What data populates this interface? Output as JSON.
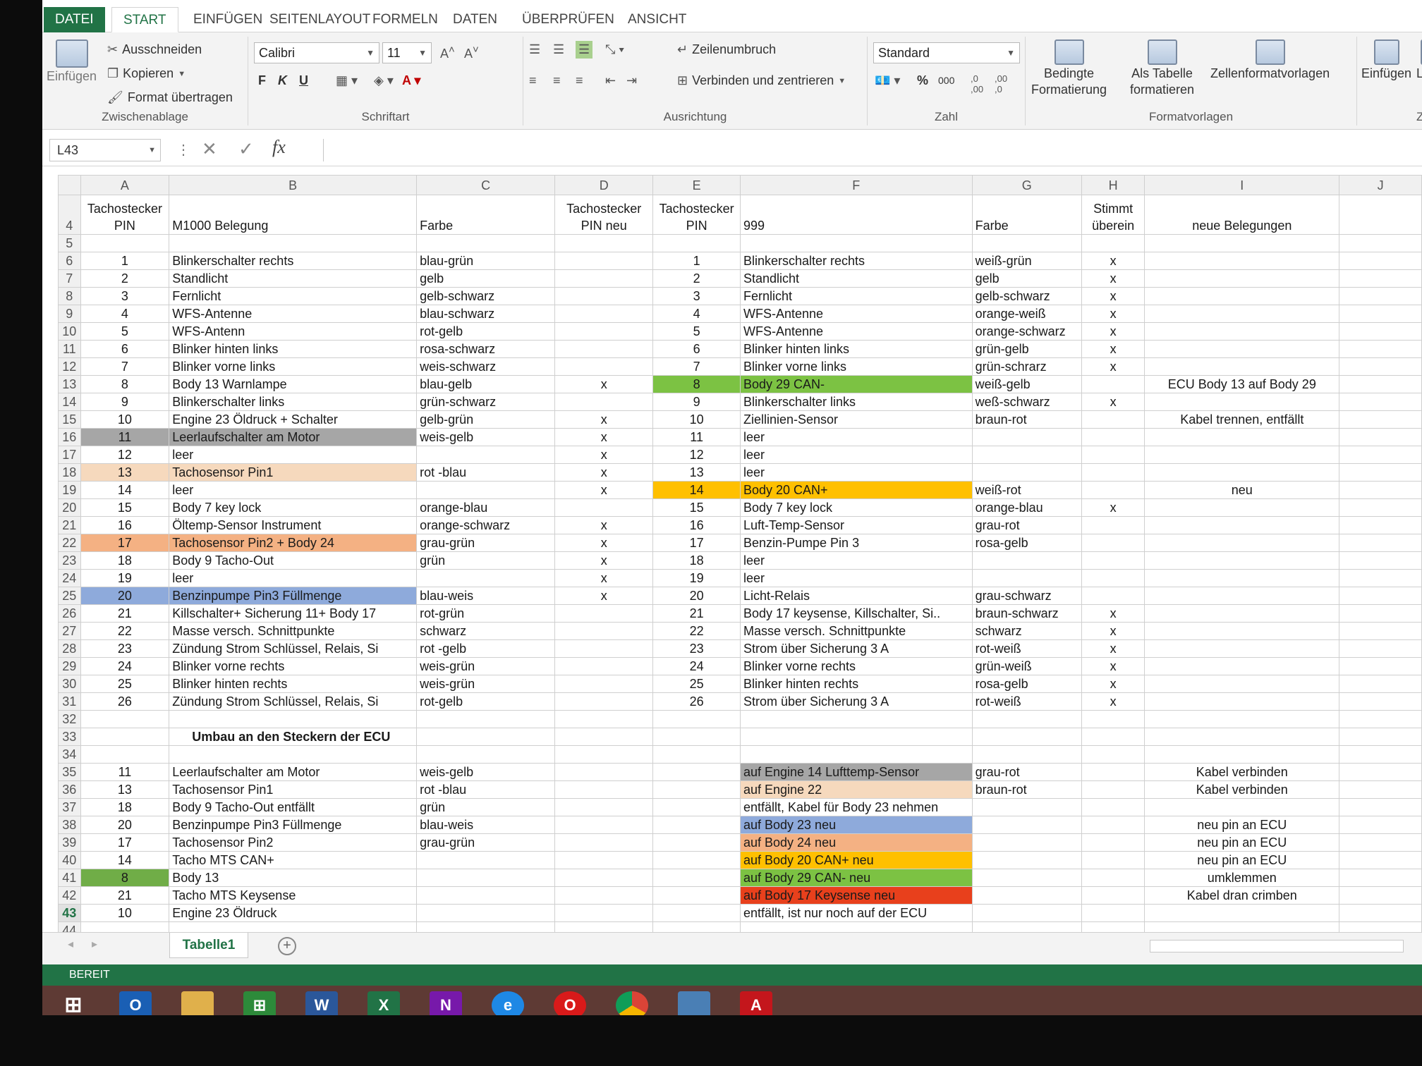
{
  "ribbon_tabs": [
    "DATEI",
    "START",
    "EINFÜGEN",
    "SEITENLAYOUT",
    "FORMELN",
    "DATEN",
    "ÜBERPRÜFEN",
    "ANSICHT"
  ],
  "clipboard": {
    "paste": "Einfügen",
    "cut": "Ausschneiden",
    "copy": "Kopieren",
    "format_painter": "Format übertragen",
    "label": "Zwischenablage"
  },
  "font": {
    "name": "Calibri",
    "size": "11",
    "bold": "F",
    "italic": "K",
    "underline": "U",
    "label": "Schriftart"
  },
  "alignment": {
    "wrap": "Zeilenumbruch",
    "merge": "Verbinden und zentrieren",
    "label": "Ausrichtung"
  },
  "number": {
    "format": "Standard",
    "percent": "%",
    "thousands": "000",
    "label": "Zahl"
  },
  "styles": {
    "conditional_1": "Bedingte",
    "conditional_2": "Formatierung",
    "as_table_1": "Als Tabelle",
    "as_table_2": "formatieren",
    "cell_styles": "Zellenformatvorlagen",
    "label": "Formatvorlagen"
  },
  "cells": {
    "insert": "Einfügen",
    "delete": "Lösch",
    "label": "Zellen"
  },
  "formula_bar": {
    "name_box": "L43",
    "fx": "fx"
  },
  "columns": [
    "A",
    "B",
    "C",
    "D",
    "E",
    "F",
    "G",
    "H",
    "I",
    "J"
  ],
  "header_row": {
    "a1": "Tachostecker",
    "a2": "PIN",
    "b": "M1000 Belegung",
    "c": "Farbe",
    "d1": "Tachostecker",
    "d2": "PIN neu",
    "e1": "Tachostecker",
    "e2": "PIN",
    "f": "999",
    "g": "Farbe",
    "h1": "Stimmt",
    "h2": "überein",
    "i": "neue Belegungen"
  },
  "rows": [
    {
      "n": "6",
      "a": "1",
      "b": "Blinkerschalter rechts",
      "c": "blau-grün",
      "d": "",
      "e": "1",
      "f": "Blinkerschalter rechts",
      "g": "weiß-grün",
      "h": "x",
      "i": ""
    },
    {
      "n": "7",
      "a": "2",
      "b": "Standlicht",
      "c": "gelb",
      "d": "",
      "e": "2",
      "f": "Standlicht",
      "g": "gelb",
      "h": "x",
      "i": ""
    },
    {
      "n": "8",
      "a": "3",
      "b": "Fernlicht",
      "c": "gelb-schwarz",
      "d": "",
      "e": "3",
      "f": "Fernlicht",
      "g": "gelb-schwarz",
      "h": "x",
      "i": ""
    },
    {
      "n": "9",
      "a": "4",
      "b": "WFS-Antenne",
      "c": "blau-schwarz",
      "d": "",
      "e": "4",
      "f": "WFS-Antenne",
      "g": "orange-weiß",
      "h": "x",
      "i": ""
    },
    {
      "n": "10",
      "a": "5",
      "b": "WFS-Antenn",
      "c": "rot-gelb",
      "d": "",
      "e": "5",
      "f": "WFS-Antenne",
      "g": "orange-schwarz",
      "h": "x",
      "i": ""
    },
    {
      "n": "11",
      "a": "6",
      "b": "Blinker hinten links",
      "c": "rosa-schwarz",
      "d": "",
      "e": "6",
      "f": "Blinker hinten links",
      "g": "grün-gelb",
      "h": "x",
      "i": ""
    },
    {
      "n": "12",
      "a": "7",
      "b": "Blinker vorne links",
      "c": "weis-schwarz",
      "d": "",
      "e": "7",
      "f": "Blinker vorne links",
      "g": "grün-schrarz",
      "h": "x",
      "i": ""
    },
    {
      "n": "13",
      "a": "8",
      "b": "Body 13 Warnlampe",
      "c": "blau-gelb",
      "d": "x",
      "e": "8",
      "f": "Body 29 CAN-",
      "g": "weiß-gelb",
      "h": "",
      "i": "ECU Body 13 auf Body 29",
      "fill_e": "#7cc243",
      "fill_f": "#7cc243"
    },
    {
      "n": "14",
      "a": "9",
      "b": "Blinkerschalter links",
      "c": "grün-schwarz",
      "d": "",
      "e": "9",
      "f": "Blinkerschalter links",
      "g": "weß-schwarz",
      "h": "x",
      "i": ""
    },
    {
      "n": "15",
      "a": "10",
      "b": "Engine 23 Öldruck + Schalter",
      "c": "gelb-grün",
      "d": "x",
      "e": "10",
      "f": "Ziellinien-Sensor",
      "g": "braun-rot",
      "h": "",
      "i": "Kabel trennen, entfällt"
    },
    {
      "n": "16",
      "a": "11",
      "b": "Leerlaufschalter am Motor",
      "c": "weis-gelb",
      "d": "x",
      "e": "11",
      "f": "leer",
      "g": "",
      "h": "",
      "i": "",
      "fill_a": "#a6a6a6",
      "fill_b": "#a6a6a6"
    },
    {
      "n": "17",
      "a": "12",
      "b": "leer",
      "c": "",
      "d": "x",
      "e": "12",
      "f": "leer",
      "g": "",
      "h": "",
      "i": ""
    },
    {
      "n": "18",
      "a": "13",
      "b": "Tachosensor Pin1",
      "c": "rot -blau",
      "d": "x",
      "e": "13",
      "f": "leer",
      "g": "",
      "h": "",
      "i": "",
      "fill_a": "#f6d9bd",
      "fill_b": "#f6d9bd"
    },
    {
      "n": "19",
      "a": "14",
      "b": "leer",
      "c": "",
      "d": "x",
      "e": "14",
      "f": "Body 20 CAN+",
      "g": "weiß-rot",
      "h": "",
      "i": "neu",
      "fill_e": "#ffc000",
      "fill_f": "#ffc000"
    },
    {
      "n": "20",
      "a": "15",
      "b": "Body 7 key lock",
      "c": "orange-blau",
      "d": "",
      "e": "15",
      "f": "Body 7 key lock",
      "g": "orange-blau",
      "h": "x",
      "i": ""
    },
    {
      "n": "21",
      "a": "16",
      "b": "Öltemp-Sensor Instrument",
      "c": "orange-schwarz",
      "d": "x",
      "e": "16",
      "f": "Luft-Temp-Sensor",
      "g": "grau-rot",
      "h": "",
      "i": ""
    },
    {
      "n": "22",
      "a": "17",
      "b": "Tachosensor Pin2 + Body 24",
      "c": "grau-grün",
      "d": "x",
      "e": "17",
      "f": "Benzin-Pumpe Pin 3",
      "g": "rosa-gelb",
      "h": "",
      "i": "",
      "fill_a": "#f4b183",
      "fill_b": "#f4b183"
    },
    {
      "n": "23",
      "a": "18",
      "b": "Body 9 Tacho-Out",
      "c": "grün",
      "d": "x",
      "e": "18",
      "f": "leer",
      "g": "",
      "h": "",
      "i": ""
    },
    {
      "n": "24",
      "a": "19",
      "b": "leer",
      "c": "",
      "d": "x",
      "e": "19",
      "f": "leer",
      "g": "",
      "h": "",
      "i": ""
    },
    {
      "n": "25",
      "a": "20",
      "b": "Benzinpumpe Pin3 Füllmenge",
      "c": "blau-weis",
      "d": "x",
      "e": "20",
      "f": "Licht-Relais",
      "g": "grau-schwarz",
      "h": "",
      "i": "",
      "fill_a": "#8eaadb",
      "fill_b": "#8eaadb"
    },
    {
      "n": "26",
      "a": "21",
      "b": "Killschalter+ Sicherung 11+ Body 17",
      "c": "rot-grün",
      "d": "",
      "e": "21",
      "f": "Body 17 keysense, Killschalter, Si..",
      "g": "braun-schwarz",
      "h": "x",
      "i": ""
    },
    {
      "n": "27",
      "a": "22",
      "b": "Masse versch. Schnittpunkte",
      "c": "schwarz",
      "d": "",
      "e": "22",
      "f": "Masse versch. Schnittpunkte",
      "g": "schwarz",
      "h": "x",
      "i": ""
    },
    {
      "n": "28",
      "a": "23",
      "b": "Zündung Strom Schlüssel, Relais, Si",
      "c": "rot -gelb",
      "d": "",
      "e": "23",
      "f": "Strom über Sicherung 3 A",
      "g": "rot-weiß",
      "h": "x",
      "i": ""
    },
    {
      "n": "29",
      "a": "24",
      "b": "Blinker vorne rechts",
      "c": "weis-grün",
      "d": "",
      "e": "24",
      "f": "Blinker vorne rechts",
      "g": "grün-weiß",
      "h": "x",
      "i": ""
    },
    {
      "n": "30",
      "a": "25",
      "b": "Blinker hinten rechts",
      "c": "weis-grün",
      "d": "",
      "e": "25",
      "f": "Blinker hinten rechts",
      "g": "rosa-gelb",
      "h": "x",
      "i": ""
    },
    {
      "n": "31",
      "a": "26",
      "b": "Zündung Strom Schlüssel, Relais, Si",
      "c": "rot-gelb",
      "d": "",
      "e": "26",
      "f": "Strom über Sicherung 3 A",
      "g": "rot-weiß",
      "h": "x",
      "i": ""
    }
  ],
  "section_title": "Umbau an den Steckern der ECU",
  "ecu_rows": [
    {
      "n": "35",
      "a": "11",
      "b": "Leerlaufschalter am Motor",
      "c": "weis-gelb",
      "f": "auf Engine 14 Lufttemp-Sensor",
      "g": "grau-rot",
      "i": "Kabel verbinden",
      "fill_f": "#a6a6a6"
    },
    {
      "n": "36",
      "a": "13",
      "b": "Tachosensor Pin1",
      "c": "rot -blau",
      "f": "auf Engine 22",
      "g": "braun-rot",
      "i": "Kabel verbinden",
      "fill_f": "#f6d9bd"
    },
    {
      "n": "37",
      "a": "18",
      "b": "Body 9 Tacho-Out entfällt",
      "c": "grün",
      "f": "entfällt, Kabel für Body 23  nehmen",
      "g": "",
      "i": ""
    },
    {
      "n": "38",
      "a": "20",
      "b": "Benzinpumpe Pin3 Füllmenge",
      "c": "blau-weis",
      "f": "auf Body 23 neu",
      "g": "",
      "i": "neu pin an ECU",
      "fill_f": "#8eaadb"
    },
    {
      "n": "39",
      "a": "17",
      "b": "Tachosensor Pin2",
      "c": "grau-grün",
      "f": "auf Body 24 neu",
      "g": "",
      "i": "neu pin an ECU",
      "fill_f": "#f4b183"
    },
    {
      "n": "40",
      "a": "14",
      "b": "Tacho MTS CAN+",
      "c": "",
      "f": "auf Body 20 CAN+ neu",
      "g": "",
      "i": "neu pin an ECU",
      "fill_f": "#ffc000"
    },
    {
      "n": "41",
      "a": "8",
      "b": "Body 13",
      "c": "",
      "f": "auf Body 29 CAN- neu",
      "g": "",
      "i": "umklemmen",
      "fill_a": "#70ad47",
      "fill_f": "#7cc243"
    },
    {
      "n": "42",
      "a": "21",
      "b": "Tacho MTS Keysense",
      "c": "",
      "f": "auf Body 17 Keysense neu",
      "g": "",
      "i": "Kabel dran crimben",
      "fill_f": "#e8401c"
    },
    {
      "n": "43",
      "a": "10",
      "b": "Engine 23 Öldruck",
      "c": "",
      "f": "entfällt, ist nur noch auf der ECU",
      "g": "",
      "i": ""
    }
  ],
  "sheet_tab": "Tabelle1",
  "status": "BEREIT",
  "taskbar_apps": [
    "windows-start",
    "outlook",
    "explorer",
    "store",
    "word",
    "excel",
    "onenote",
    "internet-explorer",
    "opera",
    "chrome",
    "network",
    "acrobat"
  ],
  "colors": {
    "excel_green": "#217346"
  }
}
